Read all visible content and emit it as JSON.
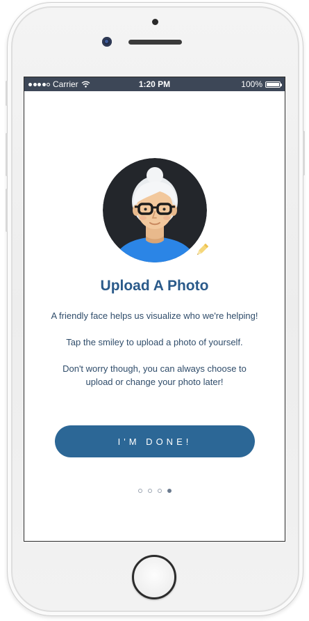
{
  "status_bar": {
    "carrier": "Carrier",
    "time": "1:20 PM",
    "battery": "100%",
    "battery_level": 1.0
  },
  "onboarding": {
    "title": "Upload A Photo",
    "line_1": "A friendly face helps us visualize who we're helping!",
    "line_2": "Tap the smiley to upload a photo of yourself.",
    "line_3": "Don't worry though, you can always choose to upload  or change your photo later!",
    "done_label": "I'M DONE!",
    "page_indicator": {
      "total": 4,
      "current": 4
    }
  },
  "icons": {
    "avatar": "person-avatar-icon",
    "edit": "pencil-icon",
    "wifi": "wifi-icon",
    "battery": "battery-icon"
  },
  "colors": {
    "status_bar": "#3d4757",
    "title": "#2a5a8a",
    "body_text": "#2f4c6a",
    "button": "#2c6796",
    "avatar_bg": "#23262b",
    "avatar_shirt": "#2b85e6",
    "pencil": "#f5d77a"
  }
}
